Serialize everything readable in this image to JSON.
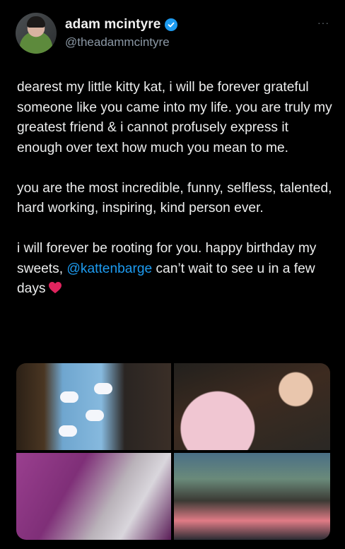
{
  "author": {
    "display_name": "adam mcintyre",
    "handle": "@theadammcintyre",
    "verified": true
  },
  "menu": {
    "more_label": "···"
  },
  "tweet": {
    "paragraph_1": "dearest my little kitty kat, i will be forever grateful someone like you came into my life. you are truly my greatest friend & i cannot profusely express it enough over text how much you mean to me.",
    "paragraph_2": "you are the most incredible, funny, selfless, talented, hard working, inspiring, kind person ever.",
    "paragraph_3_before": "i will forever be rooting for you. happy birthday my sweets, ",
    "mention": "@kattenbarge",
    "paragraph_3_after": " can’t wait to see u in a few days",
    "emoji": "red-heart"
  },
  "colors": {
    "background": "#000000",
    "text": "#e7e9ea",
    "secondary": "#8b98a5",
    "accent": "#1d9bf0",
    "heart": "#e0245e"
  },
  "media": {
    "count": 4,
    "photos": [
      "photo-1",
      "photo-2",
      "photo-3",
      "photo-4"
    ]
  }
}
